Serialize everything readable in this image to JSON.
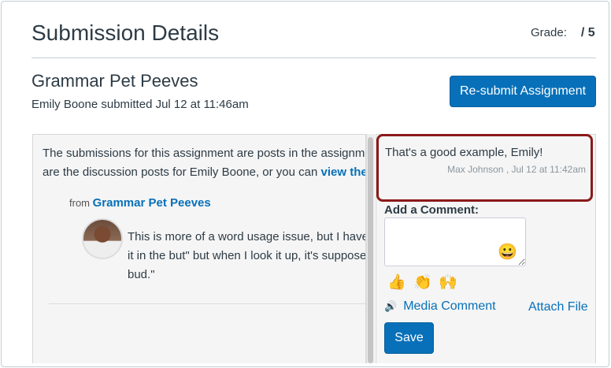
{
  "header": {
    "title": "Submission Details",
    "grade_label": "Grade:",
    "grade_value": "/ 5"
  },
  "assignment": {
    "name": "Grammar Pet Peeves",
    "submitted": "Emily Boone submitted Jul 12 at 11:46am",
    "resubmit_label": "Re-submit Assignment"
  },
  "content": {
    "intro_1": "The submissions for this assignment are posts in the assignment's discussion. Below",
    "intro_2": "are the discussion posts for Emily Boone, or you can ",
    "intro_link": "view the full discussion",
    "from_label": "from",
    "from_link": "Grammar Pet Peeves",
    "post_1": "This is more of a word usage issue, but I have always said \"nip",
    "post_2": "it in the but\" but when I look it up, it's supposed to be \"nip it in the",
    "post_3": "bud.\""
  },
  "comments": {
    "text": "That's a good example, Emily!",
    "meta": "Max Johnson , Jul 12 at 11:42am",
    "add_label": "Add a Comment:",
    "input_value": "",
    "emoji_picker": "😀",
    "quick_emojis": [
      "👍",
      "👏",
      "🙌"
    ],
    "media_label": "Media Comment",
    "attach_label": "Attach File",
    "save_label": "Save"
  }
}
